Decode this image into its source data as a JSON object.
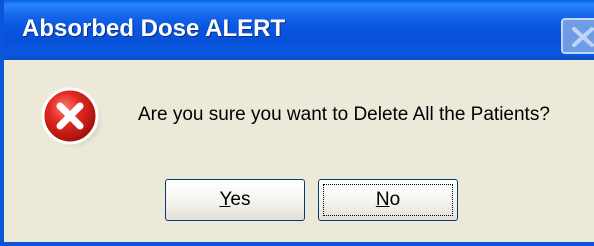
{
  "window": {
    "title": "Absorbed Dose ALERT"
  },
  "dialog": {
    "icon": "error-icon",
    "message": "Are you sure you want to Delete All the Patients?"
  },
  "buttons": {
    "yes": {
      "accel": "Y",
      "rest": "es"
    },
    "no": {
      "accel": "N",
      "rest": "o"
    }
  },
  "colors": {
    "titlebar": "#0a56df",
    "dialog_bg": "#ece9d8",
    "error_red": "#d61c1c"
  }
}
